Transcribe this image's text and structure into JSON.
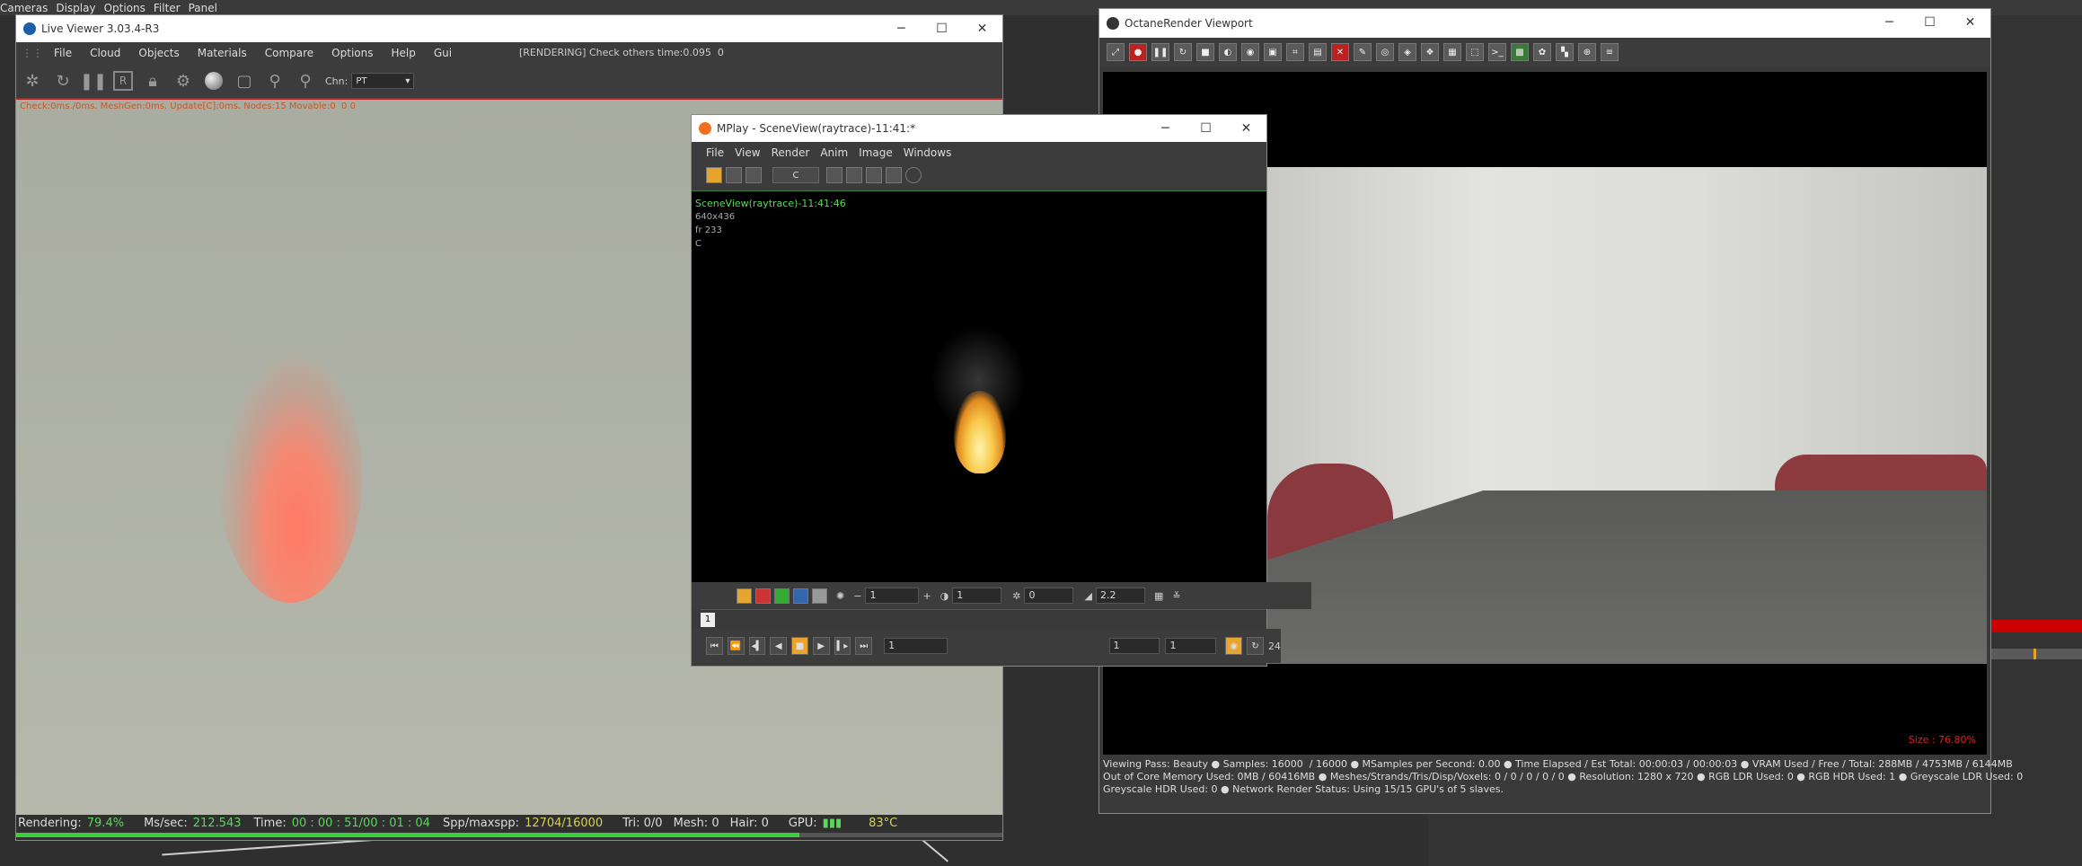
{
  "host_menu": [
    "Cameras",
    "Display",
    "Options",
    "Filter",
    "Panel"
  ],
  "live_viewer": {
    "title": "Live Viewer 3.03.4-R3",
    "menu": [
      "File",
      "Cloud",
      "Objects",
      "Materials",
      "Compare",
      "Options",
      "Help",
      "Gui"
    ],
    "render_status": "[RENDERING] Check others time:0.095  0",
    "chn_label": "Chn:",
    "chn_value": "PT",
    "check_line": "Check:0ms./0ms. MeshGen:0ms. Update[C]:0ms. Nodes:15 Movable:0  0 0",
    "status": {
      "rendering_label": "Rendering:",
      "rendering_value": "79.4%",
      "mssec_label": "Ms/sec:",
      "mssec_value": "212.543",
      "time_label": "Time:",
      "time_value": "00 : 00 : 51/00 : 01 : 04",
      "spp_label": "Spp/maxspp:",
      "spp_value": "12704/16000",
      "tri": "Tri: 0/0",
      "mesh": "Mesh: 0",
      "hair": "Hair: 0",
      "gpu_label": "GPU:",
      "temp": "83°C"
    },
    "progress": 0.794
  },
  "mplay": {
    "title": "MPlay - SceneView(raytrace)-11:41:*",
    "menu": [
      "File",
      "View",
      "Render",
      "Anim",
      "Image",
      "Windows"
    ],
    "channel": "C",
    "meta_title": "SceneView(raytrace)-11:41:46",
    "meta_res": "640x436",
    "meta_fr": "fr 233",
    "meta_c": "C",
    "ctrl": {
      "exposure": "1",
      "gamma_field": "1",
      "offset": "0",
      "gamma": "2.2"
    },
    "frame_flag": "1",
    "play": {
      "frame": "1",
      "start": "1",
      "end": "1",
      "fps": "24"
    }
  },
  "octane": {
    "title": "OctaneRender Viewport",
    "size_label": "Size : 76.80%",
    "info": [
      "Viewing Pass: Beauty ● Samples: 16000  / 16000 ● MSamples per Second: 0.00 ● Time Elapsed / Est Total: 00:00:03 / 00:00:03 ● VRAM Used / Free / Total: 288MB / 4753MB / 6144MB",
      "Out of Core Memory Used: 0MB / 60416MB ● Meshes/Strands/Tris/Disp/Voxels: 0 / 0 / 0 / 0 / 0 ● Resolution: 1280 x 720 ● RGB LDR Used: 0 ● RGB HDR Used: 1 ● Greyscale LDR Used: 0",
      "Greyscale HDR Used: 0 ● Network Render Status: Using 15/15 GPU's of 5 slaves."
    ]
  },
  "colors": {
    "accent": "#e7a530",
    "progress": "#3ccf3c",
    "alert": "#e02020"
  }
}
